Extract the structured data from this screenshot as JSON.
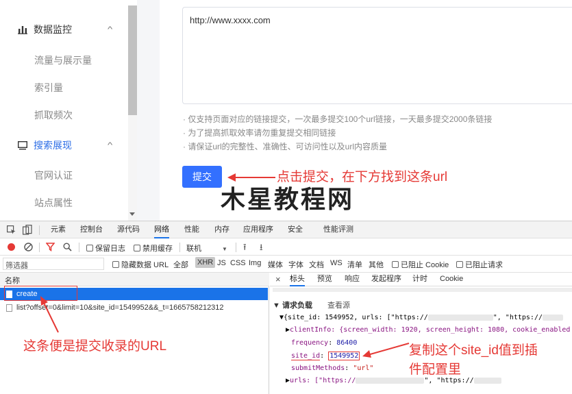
{
  "sidebar": {
    "section1_label": "数据监控",
    "section1_items": [
      "流量与展示量",
      "索引量",
      "抓取频次"
    ],
    "section2_label": "搜索展现",
    "section2_items": [
      "官网认证",
      "站点属性"
    ]
  },
  "form": {
    "url_value": "http://www.xxxx.com",
    "tips": [
      "· 仅支持页面对应的链接提交，一次最多提交100个url链接，一天最多提交2000条链接",
      "· 为了提高抓取效率请勿重复提交相同链接",
      "· 请保证url的完整性、准确性、可访问性以及url内容质量"
    ],
    "submit_label": "提交"
  },
  "annotations": {
    "submit_hint": "点击提交，在下方找到这条url",
    "watermark": "木星教程网",
    "request_hint": "这条便是提交收录的URL",
    "site_id_hint_line1": "复制这个site_id值到插",
    "site_id_hint_line2": "件配置里",
    "color": "#e53935"
  },
  "devtools": {
    "tabs": [
      "元素",
      "控制台",
      "源代码",
      "网络",
      "性能",
      "内存",
      "应用程序",
      "安全",
      "性能评测"
    ],
    "active_tab": "网络",
    "toolbar": {
      "preserve_log": "保留日志",
      "disable_cache": "禁用缓存",
      "throttle": "联机"
    },
    "filter": {
      "placeholder": "筛选器",
      "hide_data_url": "隐藏数据 URL",
      "types": [
        "全部",
        "XHR",
        "JS",
        "CSS",
        "Img",
        "媒体",
        "字体",
        "文档",
        "WS",
        "清单",
        "其他"
      ],
      "active_type": "XHR",
      "blocked_cookies": "已阻止 Cookie",
      "blocked_requests": "已阻止请求"
    },
    "list_header": "名称",
    "requests": [
      "create",
      "list?offset=0&limit=10&site_id=1549952&&_t=1665758212312"
    ],
    "detail_tabs": [
      "标头",
      "预览",
      "响应",
      "发起程序",
      "计时",
      "Cookie"
    ],
    "active_detail_tab": "标头",
    "payload": {
      "section_label": "▼ 请求负载",
      "view_source": "查看源",
      "line_top": "{site_id: 1549952, urls: [\"https://",
      "line_top_tail": "\", \"https://",
      "client_info": "clientInfo: {screen_width: 1920, screen_height: 1080, cookie_enabled",
      "frequency_key": "frequency",
      "frequency_val": "86400",
      "site_id_key": "site_id",
      "site_id_val": "1549952",
      "submit_methods_key": "submitMethods",
      "submit_methods_val": "\"url\"",
      "urls_line": "urls: [\"https://",
      "urls_tail": "\", \"https://"
    }
  }
}
